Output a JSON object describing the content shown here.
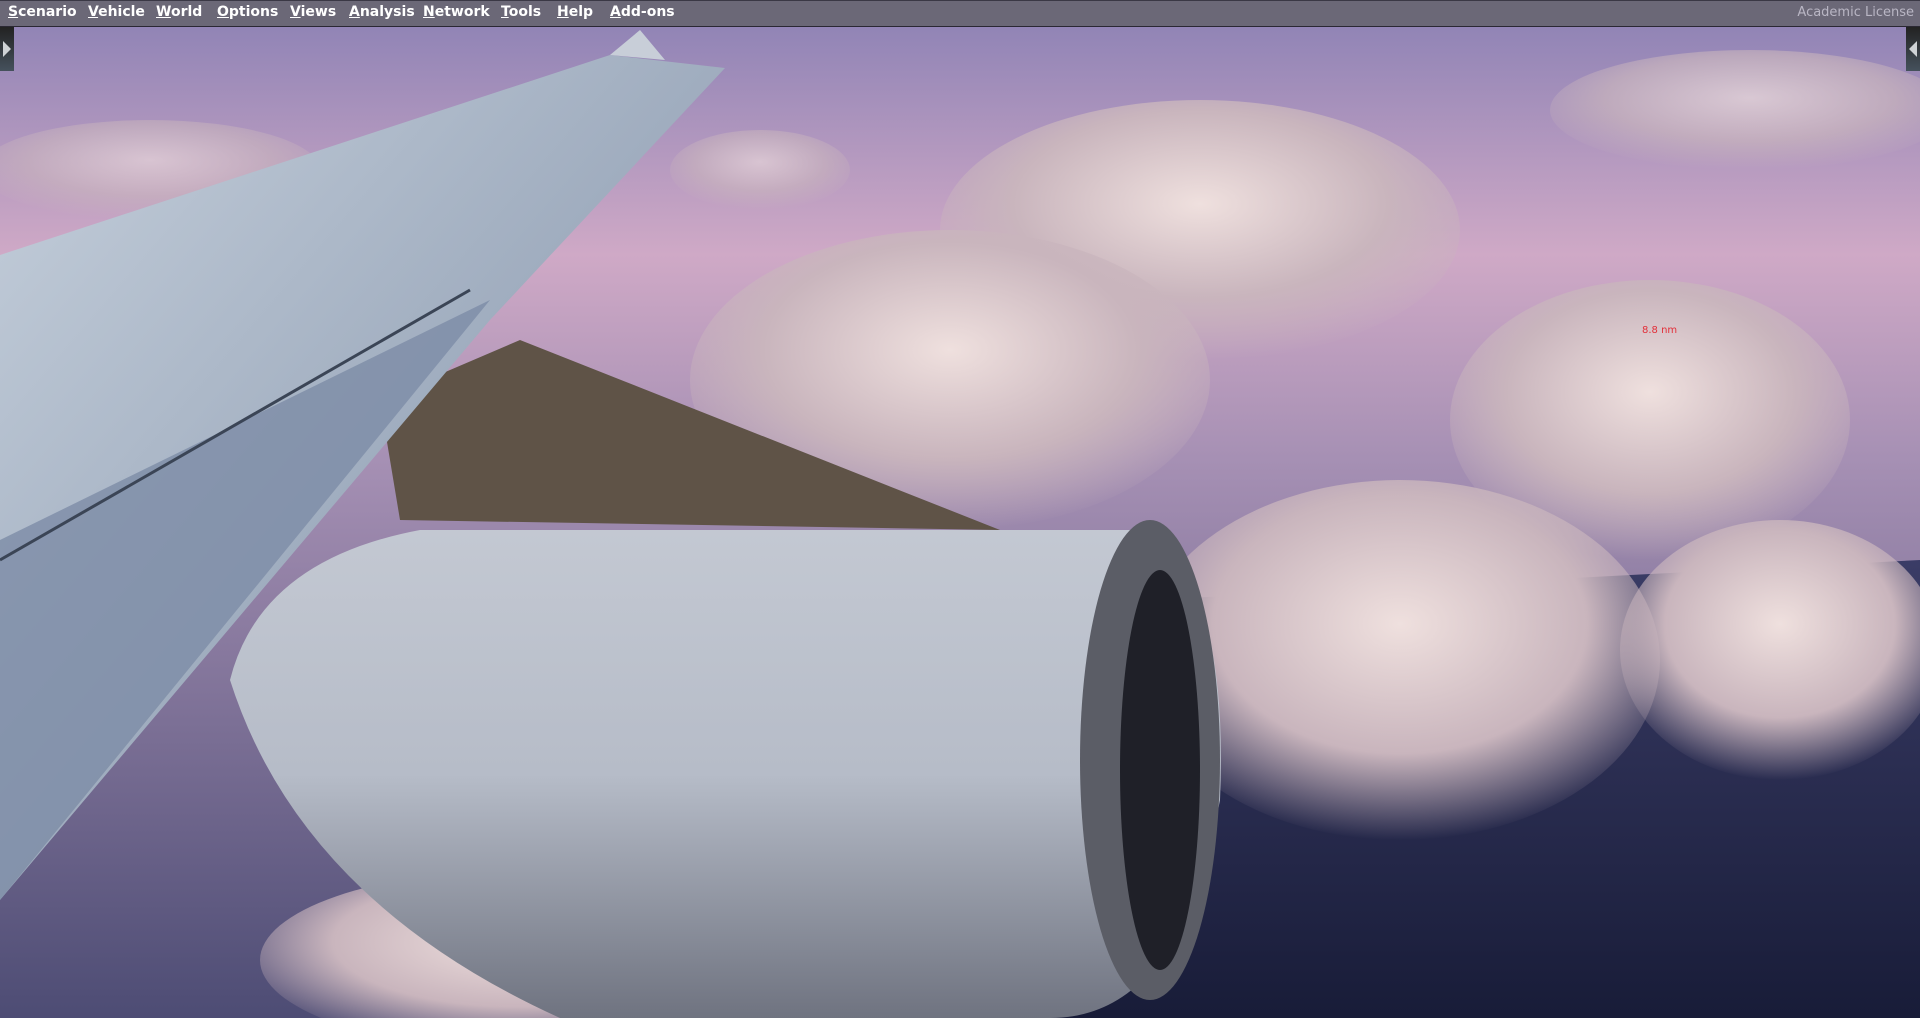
{
  "menu": [
    "Scenario",
    "Vehicle",
    "World",
    "Options",
    "Views",
    "Analysis",
    "Network",
    "Tools",
    "Help",
    "Add-ons"
  ],
  "license": "Academic License",
  "scene": {
    "range_label": "8.8 nm",
    "sky_top": "#8c7fb0",
    "sky_horizon": "#d8b3c8",
    "ocean": "#1d2342"
  }
}
